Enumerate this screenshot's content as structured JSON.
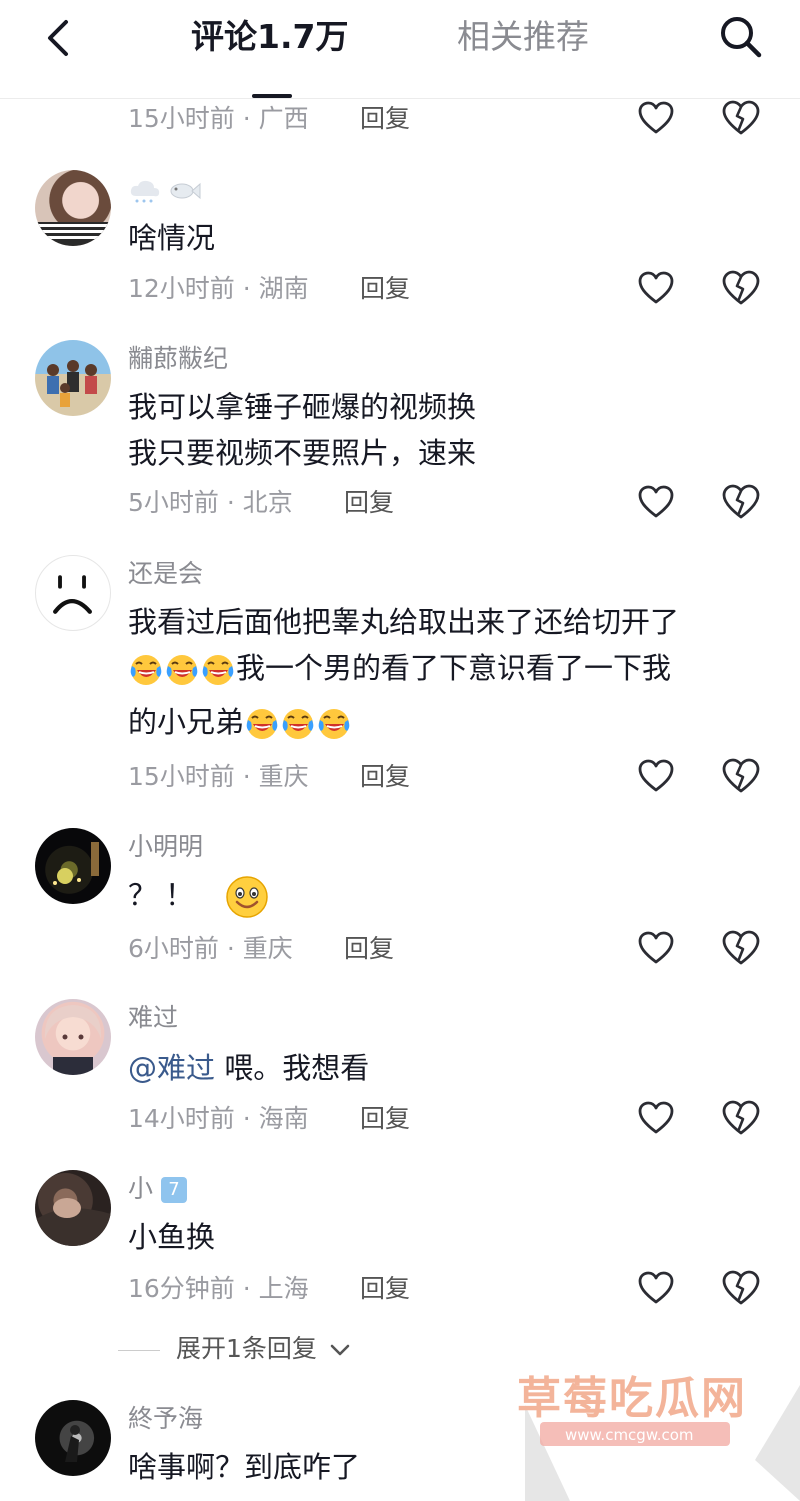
{
  "header": {
    "tab_comments": "评论1.7万",
    "tab_related": "相关推荐"
  },
  "first_meta": {
    "time": "15小时前 · 广西",
    "reply": "回复"
  },
  "comments": [
    {
      "username": "",
      "lines": [
        "啥情况"
      ],
      "time": "12小时前 · 湖南",
      "reply": "回复"
    },
    {
      "username": "黼蓈黻纪",
      "lines": [
        "我可以拿锤子砸爆的视频换",
        "我只要视频不要照片，速来"
      ],
      "time": "5小时前 · 北京",
      "reply": "回复"
    },
    {
      "username": "还是会",
      "line1": "我看过后面他把睾丸给取出来了还给切开了",
      "line2": "我一个男的看了下意识看了一下我",
      "line3": "的小兄弟",
      "time": "15小时前 · 重庆",
      "reply": "回复"
    },
    {
      "username": "小明明",
      "line1": "？！",
      "time": "6小时前 · 重庆",
      "reply": "回复"
    },
    {
      "username": "难过",
      "mention": "@难过",
      "text_after": " 喂。我想看",
      "time": "14小时前 · 海南",
      "reply": "回复"
    },
    {
      "username": "小",
      "badge": "7",
      "line1": "小鱼换",
      "time": "16分钟前 · 上海",
      "reply": "回复"
    },
    {
      "username": "終予海",
      "line1": "啥事啊？到底咋了"
    }
  ],
  "expand_replies": "展开1条回复",
  "watermark": {
    "title": "草莓吃瓜网",
    "url": "www.cmcgw.com"
  },
  "icons": {
    "back": "chevron-left-icon",
    "search": "search-icon",
    "like": "heart-outline-icon",
    "dislike": "broken-heart-icon",
    "emoji_laugh_cry": "rolling-laughing-emoji",
    "emoji_smile": "smile-emoji"
  },
  "colors": {
    "mention": "#3a5a8c",
    "watermark": "#f3b49a"
  }
}
